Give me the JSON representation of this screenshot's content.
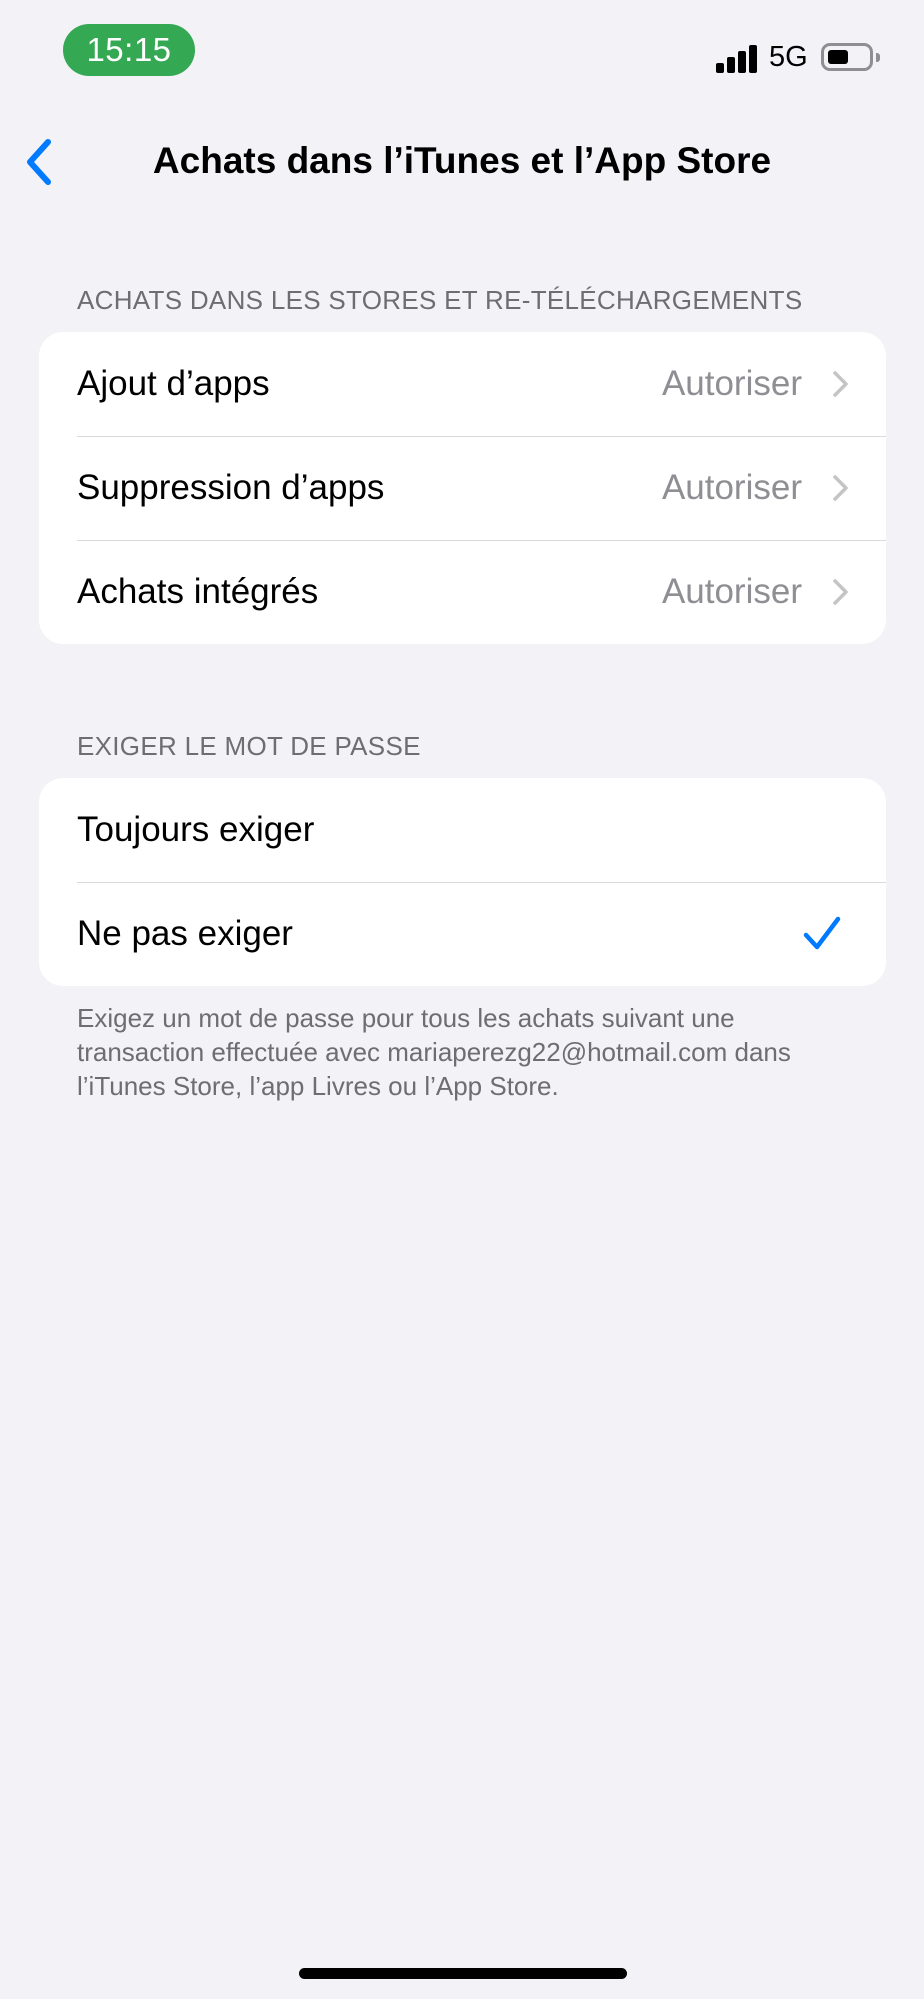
{
  "status_bar": {
    "time": "15:15",
    "network": "5G",
    "time_pill_color": "#34a853"
  },
  "nav": {
    "back_icon": "chevron-left-icon",
    "title": "Achats dans l’iTunes et l’App Store",
    "accent_color": "#007aff"
  },
  "section_store": {
    "header": "ACHATS DANS LES STORES ET RE-TÉLÉCHARGEMENTS",
    "rows": [
      {
        "label": "Ajout d’apps",
        "value": "Autoriser"
      },
      {
        "label": "Suppression d’apps",
        "value": "Autoriser"
      },
      {
        "label": "Achats intégrés",
        "value": "Autoriser"
      }
    ]
  },
  "section_password": {
    "header": "EXIGER LE MOT DE PASSE",
    "rows": [
      {
        "label": "Toujours exiger",
        "selected": false
      },
      {
        "label": "Ne pas exiger",
        "selected": true
      }
    ],
    "footer": "Exigez un mot de passe pour tous les achats suivant une transaction effectuée avec mariaperezg22@hotmail.com dans l’iTunes Store, l’app Livres ou l’App Store."
  }
}
